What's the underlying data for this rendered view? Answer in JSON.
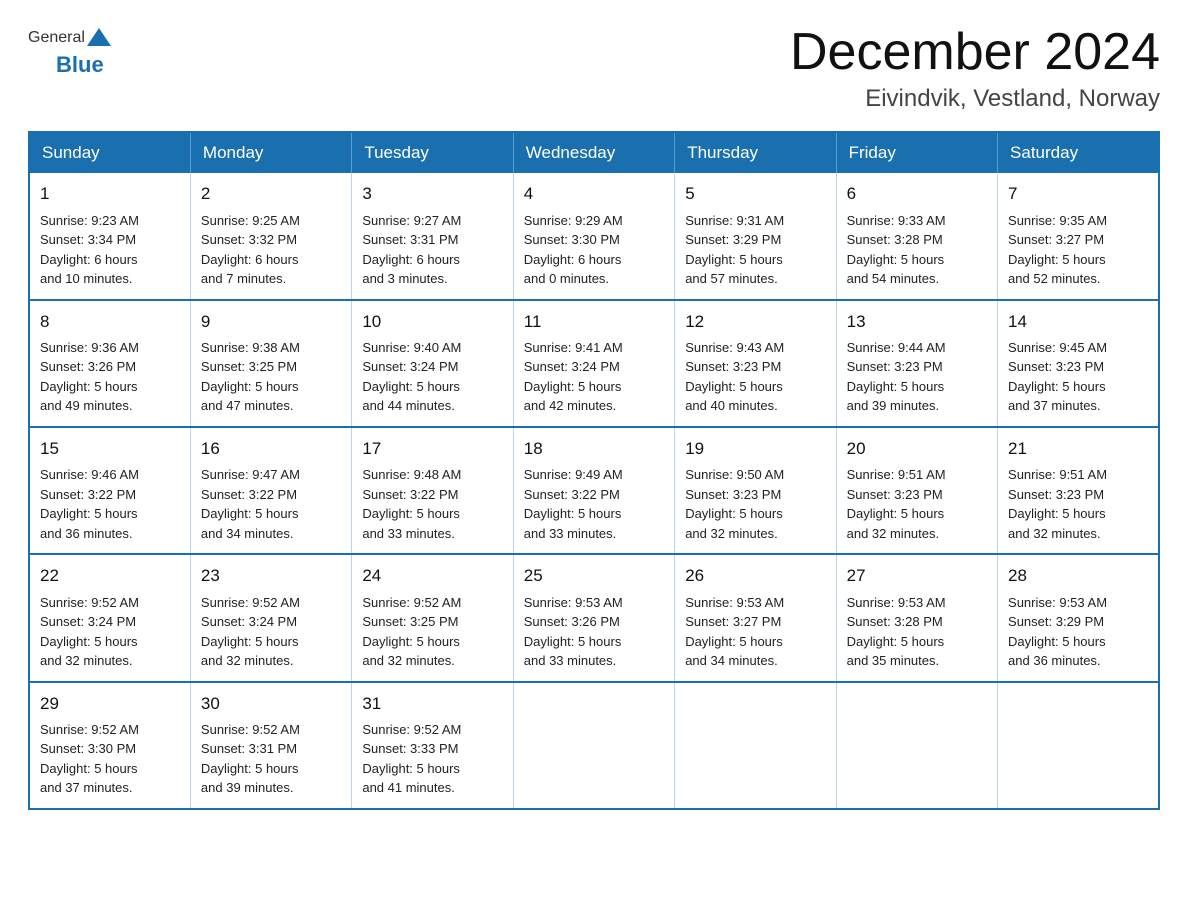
{
  "logo": {
    "general": "General",
    "blue": "Blue"
  },
  "title": {
    "month_year": "December 2024",
    "location": "Eivindvik, Vestland, Norway"
  },
  "days_of_week": [
    "Sunday",
    "Monday",
    "Tuesday",
    "Wednesday",
    "Thursday",
    "Friday",
    "Saturday"
  ],
  "weeks": [
    [
      {
        "day": "1",
        "sunrise": "9:23 AM",
        "sunset": "3:34 PM",
        "daylight": "6 hours and 10 minutes."
      },
      {
        "day": "2",
        "sunrise": "9:25 AM",
        "sunset": "3:32 PM",
        "daylight": "6 hours and 7 minutes."
      },
      {
        "day": "3",
        "sunrise": "9:27 AM",
        "sunset": "3:31 PM",
        "daylight": "6 hours and 3 minutes."
      },
      {
        "day": "4",
        "sunrise": "9:29 AM",
        "sunset": "3:30 PM",
        "daylight": "6 hours and 0 minutes."
      },
      {
        "day": "5",
        "sunrise": "9:31 AM",
        "sunset": "3:29 PM",
        "daylight": "5 hours and 57 minutes."
      },
      {
        "day": "6",
        "sunrise": "9:33 AM",
        "sunset": "3:28 PM",
        "daylight": "5 hours and 54 minutes."
      },
      {
        "day": "7",
        "sunrise": "9:35 AM",
        "sunset": "3:27 PM",
        "daylight": "5 hours and 52 minutes."
      }
    ],
    [
      {
        "day": "8",
        "sunrise": "9:36 AM",
        "sunset": "3:26 PM",
        "daylight": "5 hours and 49 minutes."
      },
      {
        "day": "9",
        "sunrise": "9:38 AM",
        "sunset": "3:25 PM",
        "daylight": "5 hours and 47 minutes."
      },
      {
        "day": "10",
        "sunrise": "9:40 AM",
        "sunset": "3:24 PM",
        "daylight": "5 hours and 44 minutes."
      },
      {
        "day": "11",
        "sunrise": "9:41 AM",
        "sunset": "3:24 PM",
        "daylight": "5 hours and 42 minutes."
      },
      {
        "day": "12",
        "sunrise": "9:43 AM",
        "sunset": "3:23 PM",
        "daylight": "5 hours and 40 minutes."
      },
      {
        "day": "13",
        "sunrise": "9:44 AM",
        "sunset": "3:23 PM",
        "daylight": "5 hours and 39 minutes."
      },
      {
        "day": "14",
        "sunrise": "9:45 AM",
        "sunset": "3:23 PM",
        "daylight": "5 hours and 37 minutes."
      }
    ],
    [
      {
        "day": "15",
        "sunrise": "9:46 AM",
        "sunset": "3:22 PM",
        "daylight": "5 hours and 36 minutes."
      },
      {
        "day": "16",
        "sunrise": "9:47 AM",
        "sunset": "3:22 PM",
        "daylight": "5 hours and 34 minutes."
      },
      {
        "day": "17",
        "sunrise": "9:48 AM",
        "sunset": "3:22 PM",
        "daylight": "5 hours and 33 minutes."
      },
      {
        "day": "18",
        "sunrise": "9:49 AM",
        "sunset": "3:22 PM",
        "daylight": "5 hours and 33 minutes."
      },
      {
        "day": "19",
        "sunrise": "9:50 AM",
        "sunset": "3:23 PM",
        "daylight": "5 hours and 32 minutes."
      },
      {
        "day": "20",
        "sunrise": "9:51 AM",
        "sunset": "3:23 PM",
        "daylight": "5 hours and 32 minutes."
      },
      {
        "day": "21",
        "sunrise": "9:51 AM",
        "sunset": "3:23 PM",
        "daylight": "5 hours and 32 minutes."
      }
    ],
    [
      {
        "day": "22",
        "sunrise": "9:52 AM",
        "sunset": "3:24 PM",
        "daylight": "5 hours and 32 minutes."
      },
      {
        "day": "23",
        "sunrise": "9:52 AM",
        "sunset": "3:24 PM",
        "daylight": "5 hours and 32 minutes."
      },
      {
        "day": "24",
        "sunrise": "9:52 AM",
        "sunset": "3:25 PM",
        "daylight": "5 hours and 32 minutes."
      },
      {
        "day": "25",
        "sunrise": "9:53 AM",
        "sunset": "3:26 PM",
        "daylight": "5 hours and 33 minutes."
      },
      {
        "day": "26",
        "sunrise": "9:53 AM",
        "sunset": "3:27 PM",
        "daylight": "5 hours and 34 minutes."
      },
      {
        "day": "27",
        "sunrise": "9:53 AM",
        "sunset": "3:28 PM",
        "daylight": "5 hours and 35 minutes."
      },
      {
        "day": "28",
        "sunrise": "9:53 AM",
        "sunset": "3:29 PM",
        "daylight": "5 hours and 36 minutes."
      }
    ],
    [
      {
        "day": "29",
        "sunrise": "9:52 AM",
        "sunset": "3:30 PM",
        "daylight": "5 hours and 37 minutes."
      },
      {
        "day": "30",
        "sunrise": "9:52 AM",
        "sunset": "3:31 PM",
        "daylight": "5 hours and 39 minutes."
      },
      {
        "day": "31",
        "sunrise": "9:52 AM",
        "sunset": "3:33 PM",
        "daylight": "5 hours and 41 minutes."
      },
      null,
      null,
      null,
      null
    ]
  ],
  "labels": {
    "sunrise": "Sunrise:",
    "sunset": "Sunset:",
    "daylight": "Daylight:"
  }
}
